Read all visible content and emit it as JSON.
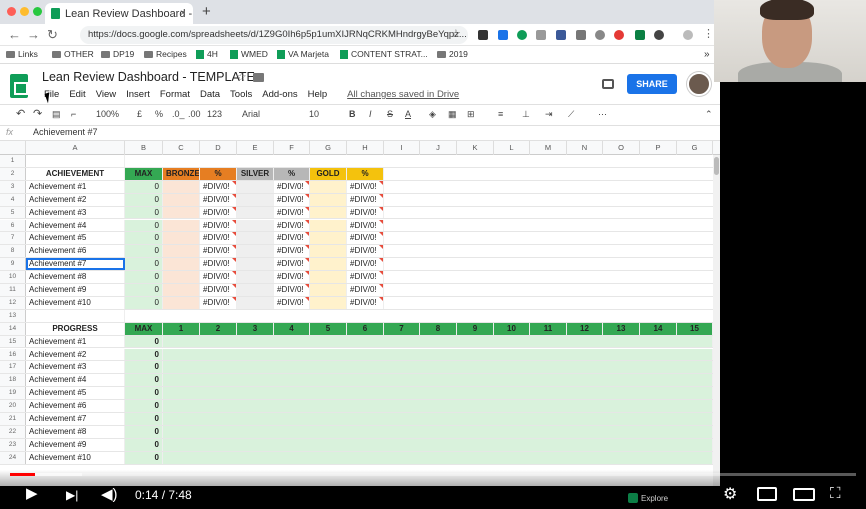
{
  "browser": {
    "tab_title": "Lean Review Dashboard - TEMP",
    "tab_close": "×",
    "new_tab": "+",
    "url": "https://docs.google.com/spreadsheets/d/1Z9G0Ih6p5p1umXIJRNqCRKMHndrgyBeYqpz...",
    "nav_back": "←",
    "nav_forward": "→",
    "nav_reload": "↻",
    "bookmarks": [
      "Links",
      "OTHER",
      "DP19",
      "Recipes",
      "4H",
      "WMED",
      "VA Marjeta",
      "CONTENT STRAT...",
      "2019"
    ],
    "bookmark_more": "»"
  },
  "sheets": {
    "title": "Lean Review Dashboard - TEMPLATE",
    "menus": [
      "File",
      "Edit",
      "View",
      "Insert",
      "Format",
      "Data",
      "Tools",
      "Add-ons",
      "Help"
    ],
    "save_status": "All changes saved in Drive",
    "share_label": "SHARE",
    "toolbar": {
      "zoom": "100%",
      "currency": "£",
      "percent": "%",
      "decimal_less": ".0_",
      "decimal_more": ".00",
      "more_formats": "123",
      "font": "Arial",
      "font_size": "10",
      "bold": "B",
      "italic": "I",
      "strike": "S",
      "text_color": "A"
    },
    "formula_label": "fx",
    "formula_value": "Achievement #7",
    "columns": [
      "A",
      "B",
      "C",
      "D",
      "E",
      "F",
      "G",
      "H",
      "I",
      "J",
      "K",
      "L",
      "M",
      "N",
      "O",
      "P",
      "G"
    ],
    "rows": [
      {
        "num": "1",
        "cells": [
          "",
          "",
          "",
          "",
          "",
          "",
          "",
          ""
        ]
      },
      {
        "num": "2",
        "cells": [
          "ACHIEVEMENT",
          "MAX",
          "BRONZE",
          "%",
          "SILVER",
          "%",
          "GOLD",
          "%"
        ]
      },
      {
        "num": "3",
        "cells": [
          "Achievement #1",
          "0",
          "",
          "#DIV/0!",
          "",
          "#DIV/0!",
          "",
          "#DIV/0!"
        ]
      },
      {
        "num": "4",
        "cells": [
          "Achievement #2",
          "0",
          "",
          "#DIV/0!",
          "",
          "#DIV/0!",
          "",
          "#DIV/0!"
        ]
      },
      {
        "num": "5",
        "cells": [
          "Achievement #3",
          "0",
          "",
          "#DIV/0!",
          "",
          "#DIV/0!",
          "",
          "#DIV/0!"
        ]
      },
      {
        "num": "6",
        "cells": [
          "Achievement #4",
          "0",
          "",
          "#DIV/0!",
          "",
          "#DIV/0!",
          "",
          "#DIV/0!"
        ]
      },
      {
        "num": "7",
        "cells": [
          "Achievement #5",
          "0",
          "",
          "#DIV/0!",
          "",
          "#DIV/0!",
          "",
          "#DIV/0!"
        ]
      },
      {
        "num": "8",
        "cells": [
          "Achievement #6",
          "0",
          "",
          "#DIV/0!",
          "",
          "#DIV/0!",
          "",
          "#DIV/0!"
        ]
      },
      {
        "num": "9",
        "cells": [
          "Achievement #7",
          "0",
          "",
          "#DIV/0!",
          "",
          "#DIV/0!",
          "",
          "#DIV/0!"
        ]
      },
      {
        "num": "10",
        "cells": [
          "Achievement #8",
          "0",
          "",
          "#DIV/0!",
          "",
          "#DIV/0!",
          "",
          "#DIV/0!"
        ]
      },
      {
        "num": "11",
        "cells": [
          "Achievement #9",
          "0",
          "",
          "#DIV/0!",
          "",
          "#DIV/0!",
          "",
          "#DIV/0!"
        ]
      },
      {
        "num": "12",
        "cells": [
          "Achievement #10",
          "0",
          "",
          "#DIV/0!",
          "",
          "#DIV/0!",
          "",
          "#DIV/0!"
        ]
      },
      {
        "num": "13",
        "cells": [
          "",
          "",
          "",
          "",
          "",
          "",
          "",
          ""
        ]
      }
    ],
    "progress_header": {
      "num": "14",
      "label": "PROGRESS",
      "max": "MAX",
      "steps": [
        "1",
        "2",
        "3",
        "4",
        "5",
        "6",
        "7",
        "8",
        "9",
        "10",
        "11",
        "12",
        "13",
        "14",
        "15"
      ]
    },
    "progress_rows": [
      {
        "num": "15",
        "label": "Achievement #1",
        "max": "0"
      },
      {
        "num": "16",
        "label": "Achievement #2",
        "max": "0"
      },
      {
        "num": "17",
        "label": "Achievement #3",
        "max": "0"
      },
      {
        "num": "18",
        "label": "Achievement #4",
        "max": "0"
      },
      {
        "num": "19",
        "label": "Achievement #5",
        "max": "0"
      },
      {
        "num": "20",
        "label": "Achievement #6",
        "max": "0"
      },
      {
        "num": "21",
        "label": "Achievement #7",
        "max": "0"
      },
      {
        "num": "22",
        "label": "Achievement #8",
        "max": "0"
      },
      {
        "num": "23",
        "label": "Achievement #9",
        "max": "0"
      },
      {
        "num": "24",
        "label": "Achievement #10",
        "max": "0"
      }
    ],
    "explore_label": "Explore"
  },
  "player": {
    "current_time": "0:14",
    "duration": "7:48",
    "played_fraction": 0.03,
    "buffered_fraction": 0.085
  },
  "colors": {
    "green_header": "#34a853",
    "light_green": "#d9f2dc",
    "bronze": "#e67e22",
    "light_bronze": "#fbe5d6",
    "silver": "#b7b7b7",
    "light_silver": "#efefef",
    "gold": "#f4c20d",
    "light_gold": "#fff2cc"
  }
}
